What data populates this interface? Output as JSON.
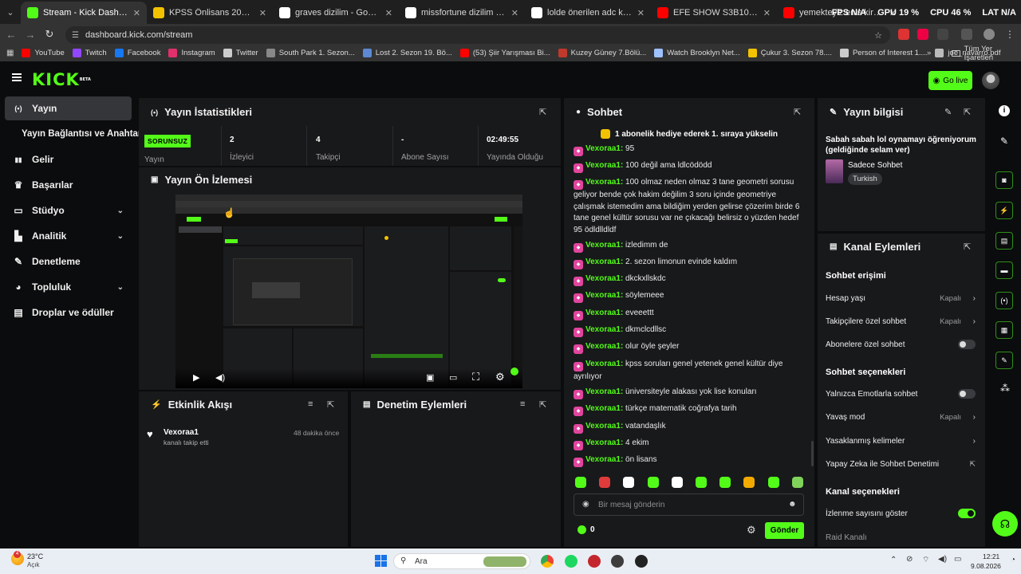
{
  "browser": {
    "tabs": [
      {
        "label": "Stream - Kick Dashboard",
        "active": true,
        "favicon": "kick-icon",
        "color": "#53fc18"
      },
      {
        "label": "KPSS Önlisans 2026 | Çalışma G",
        "favicon": "kpss-icon",
        "color": "#f2c200"
      },
      {
        "label": "graves dizilim - Google'da Ara",
        "favicon": "google-icon",
        "color": "#ffffff"
      },
      {
        "label": "missfortune dizilim - Google'da",
        "favicon": "google-icon",
        "color": "#ffffff"
      },
      {
        "label": "lolde önerilen adc karakterleri",
        "favicon": "document-icon",
        "color": "#ffffff"
      },
      {
        "label": "EFE SHOW S3B10 | ENİS KİRAZ",
        "favicon": "youtube-icon",
        "color": "#ff0000"
      },
      {
        "label": "yemekteyiz enis kirazoğlu - Yo",
        "favicon": "youtube-icon",
        "color": "#ff0000"
      }
    ],
    "overlay": {
      "fps": "FPS N/A",
      "gpu": "GPU 19 %",
      "cpu": "CPU 46 %",
      "lat": "LAT N/A"
    },
    "url": "dashboard.kick.com/stream",
    "bookmarks": [
      {
        "label": "YouTube",
        "color": "#ff0000"
      },
      {
        "label": "Twitch",
        "color": "#9146ff"
      },
      {
        "label": "Facebook",
        "color": "#1877f2"
      },
      {
        "label": "Instagram",
        "color": "#e1306c"
      },
      {
        "label": "Twitter",
        "color": "#cccccc"
      },
      {
        "label": "South Park 1. Sezon...",
        "color": "#888888"
      },
      {
        "label": "Lost 2. Sezon 19. Bö...",
        "color": "#5c88d6"
      },
      {
        "label": "(53) Şiir Yarışması Bi...",
        "color": "#ff0000"
      },
      {
        "label": "Kuzey Güney 7.Bölü...",
        "color": "#c0392b"
      },
      {
        "label": "Watch Brooklyn Net...",
        "color": "#9ec1ff"
      },
      {
        "label": "Çukur 3. Sezon 78....",
        "color": "#f2c200"
      },
      {
        "label": "Person of Interest 1....",
        "color": "#cccccc"
      },
      {
        "label": "joe_navarro.pdf",
        "color": "#bbbbbb"
      }
    ],
    "all_bookmarks": "Tüm Yer İşaretleri"
  },
  "header": {
    "logo": "KICK",
    "logo_sup": "BETA",
    "go_live": "Go live"
  },
  "sidebar": {
    "items": [
      {
        "label": "Yayın",
        "icon": "broadcast-icon",
        "glyph": "(•)"
      },
      {
        "label": "Yayın Bağlantısı ve Anahtarı",
        "icon": "",
        "glyph": ""
      },
      {
        "label": "Gelir",
        "icon": "revenue-icon",
        "glyph": "▮▮"
      },
      {
        "label": "Başarılar",
        "icon": "trophy-icon",
        "glyph": "🏆"
      },
      {
        "label": "Stüdyo",
        "icon": "studio-icon",
        "glyph": "▬"
      },
      {
        "label": "Analitik",
        "icon": "analytics-icon",
        "glyph": "▲"
      },
      {
        "label": "Denetleme",
        "icon": "wrench-icon",
        "glyph": "✎"
      },
      {
        "label": "Topluluk",
        "icon": "community-icon",
        "glyph": "◗"
      },
      {
        "label": "Droplar ve ödüller",
        "icon": "gift-icon",
        "glyph": "▤"
      }
    ]
  },
  "stats": {
    "title": "Yayın İstatistikleri",
    "status_badge": "SORUNSUZ",
    "status_label": "Yayın",
    "items": [
      {
        "value": "2",
        "label": "İzleyici"
      },
      {
        "value": "4",
        "label": "Takipçi"
      },
      {
        "value": "-",
        "label": "Abone Sayısı"
      },
      {
        "value": "02:49:55",
        "label": "Yayında Olduğu"
      }
    ]
  },
  "preview": {
    "title": "Yayın Ön İzlemesi"
  },
  "activity": {
    "title": "Etkinlik Akışı",
    "events": [
      {
        "user": "Vexoraa1",
        "text": "kanalı takip etti",
        "time": "48 dakika önce"
      }
    ]
  },
  "moderation": {
    "title": "Denetim Eylemleri"
  },
  "chat": {
    "title": "Sohbet",
    "pinned": "1 abonelik hediye ederek 1. sıraya yükselin",
    "messages": [
      {
        "user": "Vexoraa1",
        "text": "95"
      },
      {
        "user": "Vexoraa1",
        "text": "100 değil ama ldlcödödd"
      },
      {
        "user": "Vexoraa1",
        "text": "100 olmaz neden olmaz 3 tane geometri sorusu geliyor bende çok hakim değilim 3 soru içinde geometriye çalışmak istemedim ama bildiğim yerden gelirse çözerim birde 6 tane genel kültür sorusu var ne çıkacağı belirsiz o yüzden hedef 95 ödldlldldf"
      },
      {
        "user": "Vexoraa1",
        "text": "izledimm de"
      },
      {
        "user": "Vexoraa1",
        "text": "2. sezon limonun evinde kaldım"
      },
      {
        "user": "Vexoraa1",
        "text": "dkckxllskdc"
      },
      {
        "user": "Vexoraa1",
        "text": "söylemeee"
      },
      {
        "user": "Vexoraa1",
        "text": "eveeettt"
      },
      {
        "user": "Vexoraa1",
        "text": "dkmclcdllsc"
      },
      {
        "user": "Vexoraa1",
        "text": "olur öyle şeyler"
      },
      {
        "user": "Vexoraa1",
        "text": "kpss soruları genel yetenek genel kültür diye ayrılıyor"
      },
      {
        "user": "Vexoraa1",
        "text": "üniversiteyle alakası yok lise konuları"
      },
      {
        "user": "Vexoraa1",
        "text": "türkçe matematik coğrafya tarih"
      },
      {
        "user": "Vexoraa1",
        "text": "vatandaşlık"
      },
      {
        "user": "Vexoraa1",
        "text": "4 ekim"
      },
      {
        "user": "Vexoraa1",
        "text": "ön lisans"
      }
    ],
    "input_placeholder": "Bir mesaj gönderin",
    "points": "0",
    "send": "Gönder"
  },
  "stream_info": {
    "title": "Yayın bilgisi",
    "stream_title": "Sabah sabah lol oynamayı öğreniyorum (geldiğinde selam ver)",
    "category": "Sadece Sohbet",
    "tag": "Turkish"
  },
  "channel_actions": {
    "title": "Kanal Eylemleri",
    "chat_access": "Sohbet erişimi",
    "account_age": {
      "label": "Hesap yaşı",
      "value": "Kapalı"
    },
    "followers_only": {
      "label": "Takipçilere özel sohbet",
      "value": "Kapalı"
    },
    "subs_only": {
      "label": "Abonelere özel sohbet"
    },
    "chat_options": "Sohbet seçenekleri",
    "emotes_only": {
      "label": "Yalnızca Emotlarla sohbet"
    },
    "slow_mode": {
      "label": "Yavaş mod",
      "value": "Kapalı"
    },
    "banned_words": {
      "label": "Yasaklanmış kelimeler"
    },
    "ai_moderation": {
      "label": "Yapay Zeka ile Sohbet Denetimi"
    },
    "channel_options": "Kanal seçenekleri",
    "show_viewers": {
      "label": "İzlenme sayısını göster"
    },
    "raid": {
      "label": "Raid Kanalı"
    }
  },
  "taskbar": {
    "weather_temp": "23°C",
    "weather_desc": "Açık",
    "search": "Ara",
    "time": "12:21",
    "date": "9.08.2026"
  }
}
